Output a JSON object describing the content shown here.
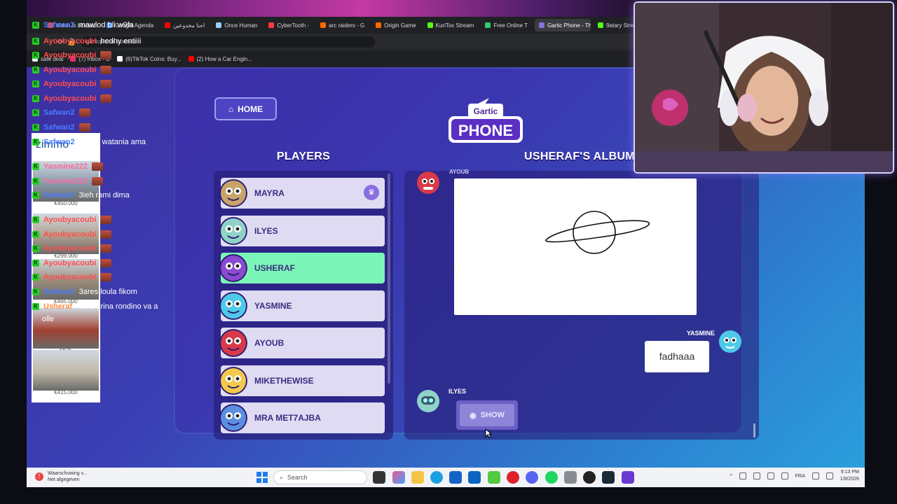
{
  "browser": {
    "tabs": [
      {
        "label": "Video is blocked",
        "color": "#ff3d3d"
      },
      {
        "label": "Google Agenda",
        "color": "#4285f4"
      },
      {
        "label": "احنا مخدوعين",
        "color": "#ff0000"
      },
      {
        "label": "Once Human",
        "color": "#9ad0ff"
      },
      {
        "label": "CyberTooth -",
        "color": "#ff3d3d"
      },
      {
        "label": "arc raiders - G",
        "color": "#ff6a00"
      },
      {
        "label": "Origin Game",
        "color": "#ff6a00"
      },
      {
        "label": "KuriTox Stream",
        "color": "#53fc18"
      },
      {
        "label": "Free Online T",
        "color": "#2ecc71"
      },
      {
        "label": "Gartic Phone - The Tele",
        "color": "#8a6fe0"
      },
      {
        "label": "9atary Stream",
        "color": "#53fc18"
      }
    ],
    "url": "garticphone.com/en",
    "bookmarks": [
      {
        "label": "safe deal",
        "color": "#ffffff"
      },
      {
        "label": "(7) Inbox • D",
        "color": "#e1306c"
      },
      {
        "label": "(6)TikTok Coins: Buy...",
        "color": "#ffffff"
      },
      {
        "label": "(2) How a Car Engin...",
        "color": "#ff0000"
      }
    ]
  },
  "game": {
    "home_label": "HOME",
    "logo_top": "Gartic",
    "logo_bottom": "PHONE",
    "players_title": "PLAYERS",
    "album_title": "USHERAF'S ALBUM",
    "players": [
      {
        "name": "MAYRA",
        "host": true,
        "active": false,
        "color": "#c9a46a"
      },
      {
        "name": "ILYES",
        "host": false,
        "active": false,
        "color": "#8fd3c8"
      },
      {
        "name": "USHERAF",
        "host": false,
        "active": true,
        "color": "#8a4bd0"
      },
      {
        "name": "YASMINE",
        "host": false,
        "active": false,
        "color": "#4fc9e8"
      },
      {
        "name": "AYOUB",
        "host": false,
        "active": false,
        "color": "#d83a4a"
      },
      {
        "name": "MIKETHEWISE",
        "host": false,
        "active": false,
        "color": "#f2c94c"
      },
      {
        "name": "MRA MET7AJBA",
        "host": false,
        "active": false,
        "color": "#5b8fe0"
      }
    ],
    "album": {
      "drawing_author": "AYOUB",
      "answer_author": "YASMINE",
      "answer_text": "fadhaaa",
      "next_author": "ILYES",
      "show_label": "SHOW"
    }
  },
  "chat": [
    {
      "user": "Safwan2",
      "text": "mawlod bli w9fa",
      "color": "#4a7bff"
    },
    {
      "user": "Ayoubyacoubi",
      "text": "hedhy entiiii",
      "color": "#ff4d4d"
    },
    {
      "user": "Ayoubyacoubi",
      "text": "",
      "color": "#ff4d4d"
    },
    {
      "user": "Ayoubyacoubi",
      "text": "",
      "color": "#ff4d4d"
    },
    {
      "user": "Ayoubyacoubi",
      "text": "",
      "color": "#ff4d4d"
    },
    {
      "user": "Ayoubyacoubi",
      "text": "",
      "color": "#ff4d4d"
    },
    {
      "user": "Safwan2",
      "text": "",
      "color": "#4a7bff"
    },
    {
      "user": "Safwan2",
      "text": "",
      "color": "#4a7bff"
    },
    {
      "user": "Safwan2",
      "text": "rsam l watania ama",
      "color": "#4a7bff"
    },
    {
      "user": "Yasmine222",
      "text": "",
      "color": "#ff6aa0"
    },
    {
      "user": "Yasmine222",
      "text": "",
      "color": "#ff6aa0"
    },
    {
      "user": "Safwan2",
      "text": "3ieh rami dima",
      "color": "#4a7bff"
    },
    {
      "user": "Ayoubyacoubi",
      "text": "",
      "color": "#ff4d4d"
    },
    {
      "user": "Ayoubyacoubi",
      "text": "",
      "color": "#ff4d4d"
    },
    {
      "user": "Ayoubyacoubi",
      "text": "",
      "color": "#ff4d4d"
    },
    {
      "user": "Ayoubyacoubi",
      "text": "",
      "color": "#ff4d4d"
    },
    {
      "user": "Ayoubyacoubi",
      "text": "",
      "color": "#ff4d4d"
    },
    {
      "user": "Safwan2",
      "text": "3ares loula fikom",
      "color": "#4a7bff"
    },
    {
      "user": "Usheraf",
      "text": "l'eole 9rina rondino va a",
      "color": "#ff8a3d"
    },
    {
      "user": "",
      "text": "olle",
      "color": "#ffffff"
    }
  ],
  "ad": {
    "logo": "zimmo",
    "prices": [
      "€450.000",
      "€299.000",
      "€465.000",
      "€625",
      "€415.000"
    ]
  },
  "taskbar": {
    "notification_title": "Waarschuwing v...",
    "notification_sub": "Net afgegeven",
    "search_placeholder": "Search",
    "language": "FRA",
    "time": "9:13 PM",
    "date": "1/8/2026"
  }
}
